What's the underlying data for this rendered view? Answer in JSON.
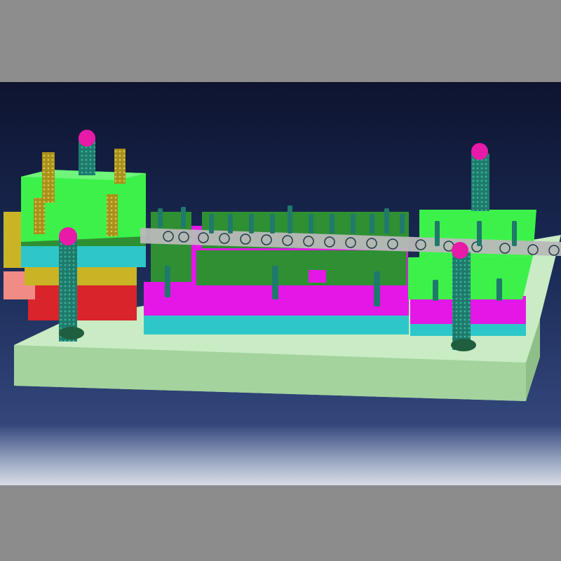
{
  "viewer": {
    "background_top": "#0e1430",
    "background_bottom": "#3a4e85",
    "frame_color": "#8e8e8e"
  },
  "model": {
    "colors": {
      "base_plate": "#c9ecc4",
      "plate_green": "#3cf24a",
      "plate_dark_green": "#2f8f33",
      "plate_magenta": "#e418e6",
      "plate_cyan": "#2ec7c9",
      "plate_yellow": "#c9b426",
      "plate_red": "#d8242a",
      "plate_salmon": "#f08b86",
      "pillar": "#1f7a6b",
      "pillar_head": "#e81aa8",
      "strip": "#b9b9b9"
    },
    "icons": [
      "guide-pillar-icon",
      "screw-icon",
      "strip-material-icon"
    ]
  }
}
